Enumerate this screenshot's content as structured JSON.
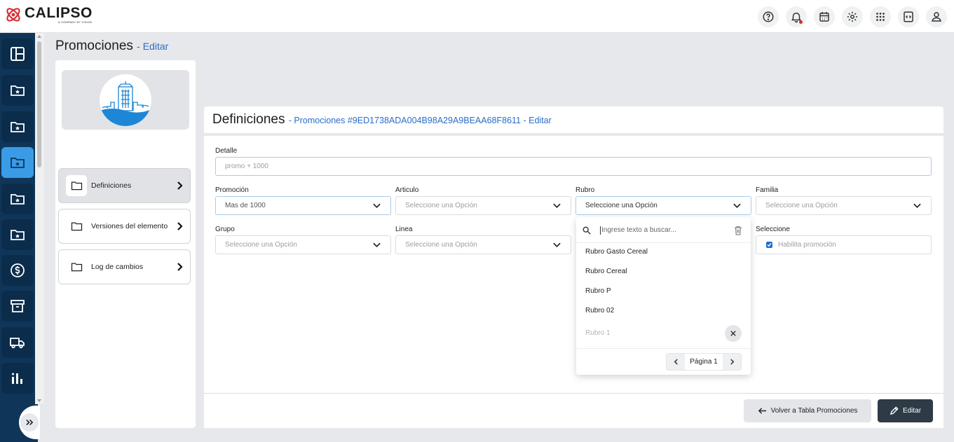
{
  "brand": {
    "name": "CALIPSO",
    "tagline": "A COMPANY BY VISION"
  },
  "topbar": {
    "icons": [
      "help-icon",
      "bell-icon",
      "calendar-icon",
      "settings-icon",
      "apps-grid-icon",
      "code-window-icon",
      "user-icon"
    ]
  },
  "sidebar": {
    "items": [
      "dashboard-icon",
      "folder-star-icon",
      "folder-star-icon",
      "folder-star-icon",
      "folder-star-icon",
      "folder-star-icon",
      "dollar-icon",
      "archive-icon",
      "truck-icon",
      "chart-icon"
    ],
    "active_index": 3
  },
  "page": {
    "title": "Promociones",
    "edit_link": "- Editar"
  },
  "left_menu": [
    {
      "label": "Definiciones"
    },
    {
      "label": "Versiones del elemento"
    },
    {
      "label": "Log de cambios"
    }
  ],
  "main": {
    "title": "Definiciones",
    "subtitle": "- Promociones #9ED1738ADA004B98A29A9BEAA68F8611 - Editar"
  },
  "form": {
    "detalle": {
      "label": "Detalle",
      "value": "promo + 1000"
    },
    "promocion": {
      "label": "Promoción",
      "value": "Mas de 1000"
    },
    "articulo": {
      "label": "Articulo",
      "value": "Seleccione una Opción"
    },
    "rubro": {
      "label": "Rubro",
      "value": "Seleccione una Opción"
    },
    "familia": {
      "label": "Familia",
      "value": "Seleccione una Opción"
    },
    "grupo": {
      "label": "Grupo",
      "value": "Seleccione una Opción"
    },
    "linea": {
      "label": "Linea",
      "value": "Seleccione una Opción"
    },
    "seleccione": {
      "label": "Seleccione",
      "checkbox_label": "Habilita promoción",
      "checked": true
    }
  },
  "dropdown": {
    "search_placeholder": "Ingrese texto a buscar...",
    "options": [
      "Rubro Gasto Cereal",
      "Rubro Cereal",
      "Rubro P",
      "Rubro 02"
    ],
    "muted_option": "Rubro 1",
    "page_label": "Página 1"
  },
  "footer": {
    "back_label": "Volver a Tabla Promociones",
    "edit_label": "Editar"
  },
  "colors": {
    "sidebar": "#0f3658",
    "active": "#3a9be6",
    "link": "#2a6dc9",
    "primary_button": "#2e3a46"
  }
}
